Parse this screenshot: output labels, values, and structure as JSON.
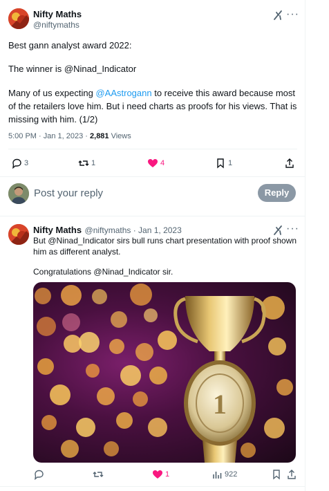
{
  "main_tweet": {
    "author_name": "Nifty Maths",
    "author_handle": "@niftymaths",
    "line1": "Best gann analyst award 2022:",
    "line2": "The winner is @Ninad_Indicator",
    "para_prefix": "Many of us expecting ",
    "para_mention": "@AAstrogann",
    "para_rest_line1": " to receive this award because most",
    "para_line2": "of the retailers love him. But i need charts as proofs for his views. That is",
    "para_line3": "missing with him. (1/2)",
    "timestamp": "5:00 PM · Jan 1, 2023 · ",
    "views_count": "2,881",
    "views_label": " Views",
    "replies": "3",
    "retweets": "1",
    "likes": "4",
    "bookmarks": "1"
  },
  "reply_box": {
    "placeholder": "Post your reply",
    "button_label": "Reply"
  },
  "reply_tweet": {
    "author_name": "Nifty Maths",
    "meta": "@niftymaths · Jan 1, 2023",
    "line1": "But @Ninad_Indicator sirs bull runs chart presentation with proof shown",
    "line2": "him as different analyst.",
    "line3": "Congratulations @Ninad_Indicator sir.",
    "likes": "1",
    "views": "922"
  },
  "media": {
    "trophy_number": "1"
  },
  "colors": {
    "accent": "#1d9bf0",
    "like": "#f91880",
    "muted": "#536471"
  }
}
